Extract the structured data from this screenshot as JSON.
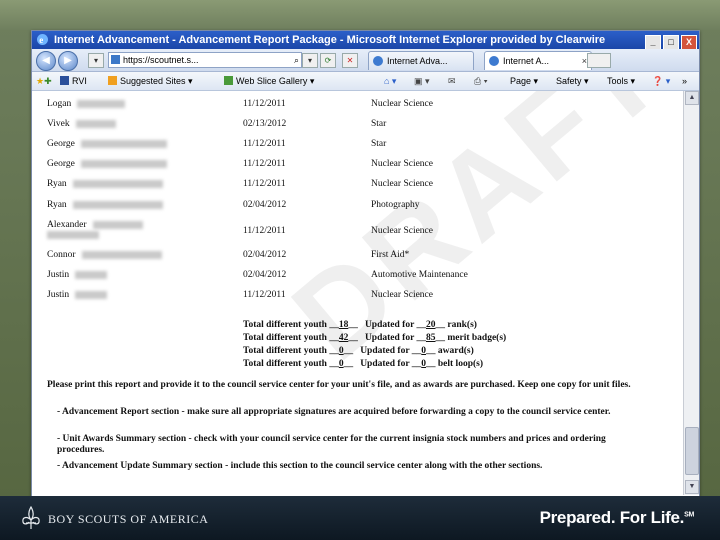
{
  "window": {
    "title": "Internet Advancement - Advancement Report Package - Microsoft Internet Explorer provided by Clearwire",
    "controls": {
      "minimize": "_",
      "maximize": "□",
      "close": "X"
    }
  },
  "addressbar": {
    "url": "https://scoutnet.s...",
    "search_symbol": "⌕",
    "tabs": [
      {
        "label": "Internet Adva..."
      },
      {
        "label": "Internet A..."
      }
    ],
    "tab_close": "×"
  },
  "favorites": {
    "items": [
      {
        "label": "RVI"
      },
      {
        "label": "Suggested Sites ▾"
      },
      {
        "label": "Web Slice Gallery ▾"
      }
    ],
    "tools": [
      {
        "label": "Page ▾"
      },
      {
        "label": "Safety ▾"
      },
      {
        "label": "Tools ▾"
      }
    ]
  },
  "report": {
    "rows": [
      {
        "name": "Logan",
        "date": "11/12/2011",
        "award": "Nuclear Science"
      },
      {
        "name": "Vivek",
        "date": "02/13/2012",
        "award": "Star"
      },
      {
        "name": "George",
        "date": "11/12/2011",
        "award": "Star"
      },
      {
        "name": "George",
        "date": "11/12/2011",
        "award": "Nuclear Science"
      },
      {
        "name": "Ryan",
        "date": "11/12/2011",
        "award": "Nuclear Science"
      },
      {
        "name": "Ryan",
        "date": "02/04/2012",
        "award": "Photography"
      },
      {
        "name": "Alexander",
        "date": "11/12/2011",
        "award": "Nuclear Science"
      },
      {
        "name": "Connor",
        "date": "02/04/2012",
        "award": "First Aid*"
      },
      {
        "name": "Justin",
        "date": "02/04/2012",
        "award": "Automotive Maintenance"
      },
      {
        "name": "Justin",
        "date": "11/12/2011",
        "award": "Nuclear Science"
      }
    ],
    "totals": [
      {
        "label": "Total different youth",
        "youth": "18",
        "updated_for": "Updated for",
        "count": "20",
        "kind": "rank(s)"
      },
      {
        "label": "Total different youth",
        "youth": "42",
        "updated_for": "Updated for",
        "count": "85",
        "kind": "merit badge(s)"
      },
      {
        "label": "Total different youth",
        "youth": "0",
        "updated_for": "Updated for",
        "count": "0",
        "kind": "award(s)"
      },
      {
        "label": "Total different youth",
        "youth": "0",
        "updated_for": "Updated for",
        "count": "0",
        "kind": "belt loop(s)"
      }
    ],
    "notes": [
      "Please print this report and provide it to the council service center for your unit's file, and as awards are purchased. Keep one copy for unit files.",
      "- Advancement Report section - make sure all appropriate signatures are acquired before forwarding a copy to the council service center.",
      "- Unit Awards Summary section - check with your council service center for the current insignia stock numbers and prices and ordering procedures.",
      "- Advancement Update Summary section - include this section to the council service center along with the other sections."
    ],
    "watermark": "DRAFT"
  },
  "footer": {
    "organization": "BOY SCOUTS OF AMERICA",
    "tagline": "Prepared. For Life.",
    "trademark": "SM"
  }
}
